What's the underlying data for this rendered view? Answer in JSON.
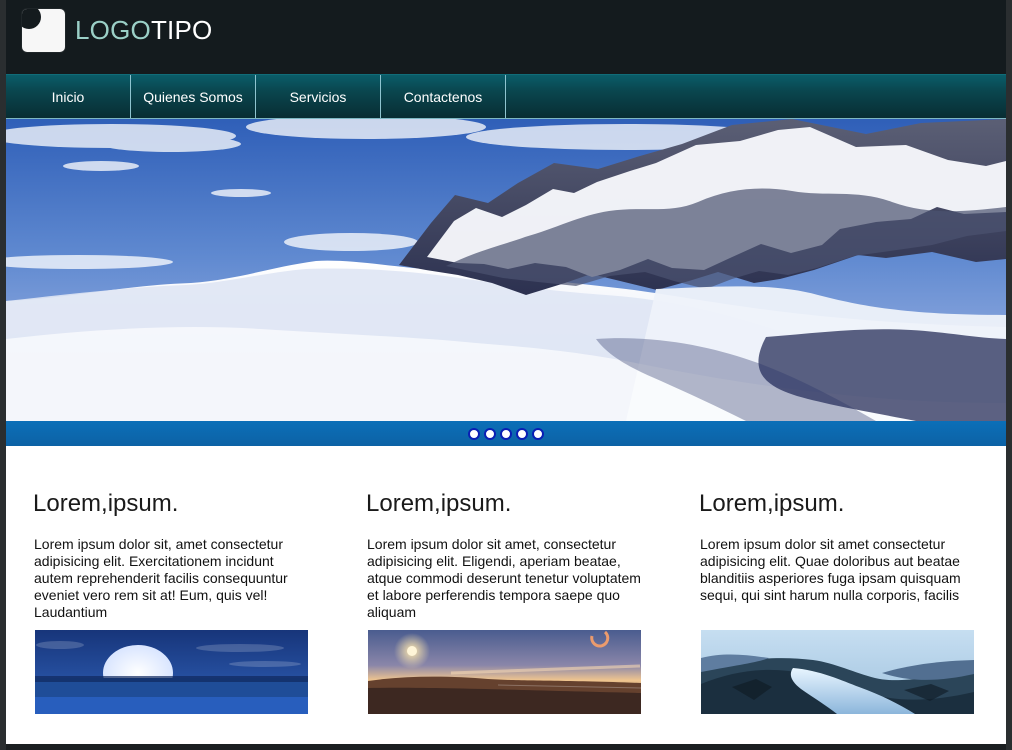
{
  "header": {
    "logo": {
      "text_part_1": "LOGO",
      "text_part_2": "TIPO",
      "icon": "logo-mark-icon"
    }
  },
  "nav": {
    "items": [
      {
        "label": "Inicio"
      },
      {
        "label": "Quienes Somos"
      },
      {
        "label": "Servicios"
      },
      {
        "label": "Contactenos"
      }
    ]
  },
  "hero": {
    "image": "snowy-mountains-image",
    "slider_dots": 5
  },
  "columns": [
    {
      "title": "Lorem,ipsum.",
      "text": "Lorem ipsum dolor sit, amet consectetur adipisicing elit. Exercitationem incidunt autem reprehenderit facilis consequuntur eveniet vero rem sit at! Eum, quis vel! Laudantium",
      "image": "moon-over-water-image"
    },
    {
      "title": "Lorem,ipsum.",
      "text": "Lorem ipsum dolor sit amet, consectetur adipisicing elit. Eligendi, aperiam beatae, atque commodi deserunt tenetur voluptatem et labore perferendis tempora saepe quo aliquam",
      "image": "sunset-horizon-image"
    },
    {
      "title": "Lorem,ipsum.",
      "text": "Lorem ipsum dolor sit amet consectetur adipisicing elit. Quae doloribus aut beatae blanditiis asperiores fuga ipsam quisquam sequi, qui sint harum nulla corporis, facilis",
      "image": "icy-river-image"
    }
  ],
  "colors": {
    "header_bg": "#141b1e",
    "nav_top": "#0a5d69",
    "nav_bottom": "#082d33",
    "slider_blue": "#0b6fb8",
    "logo_accent": "#9bd0c7"
  }
}
